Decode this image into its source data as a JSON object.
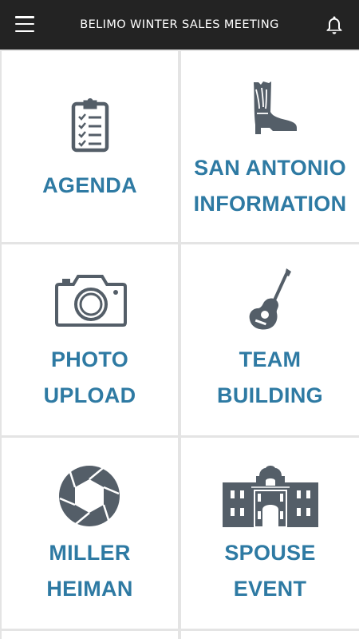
{
  "header": {
    "title": "BELIMO WINTER SALES MEETING"
  },
  "colors": {
    "accent": "#2e7aa3",
    "icon": "#545e68",
    "topbar": "#232323",
    "tile_bg": "#ffffff",
    "grid_gap": "#e4e4e4"
  },
  "tiles": [
    {
      "label": "AGENDA",
      "icon": "clipboard-checklist-icon"
    },
    {
      "label": "SAN ANTONIO\nINFORMATION",
      "icon": "cowboy-boot-icon"
    },
    {
      "label": "PHOTO\nUPLOAD",
      "icon": "camera-icon"
    },
    {
      "label": "TEAM\nBUILDING",
      "icon": "acoustic-guitar-icon"
    },
    {
      "label": "MILLER\nHEIMAN",
      "icon": "camera-aperture-icon"
    },
    {
      "label": "SPOUSE\nEVENT",
      "icon": "alamo-building-icon"
    }
  ]
}
